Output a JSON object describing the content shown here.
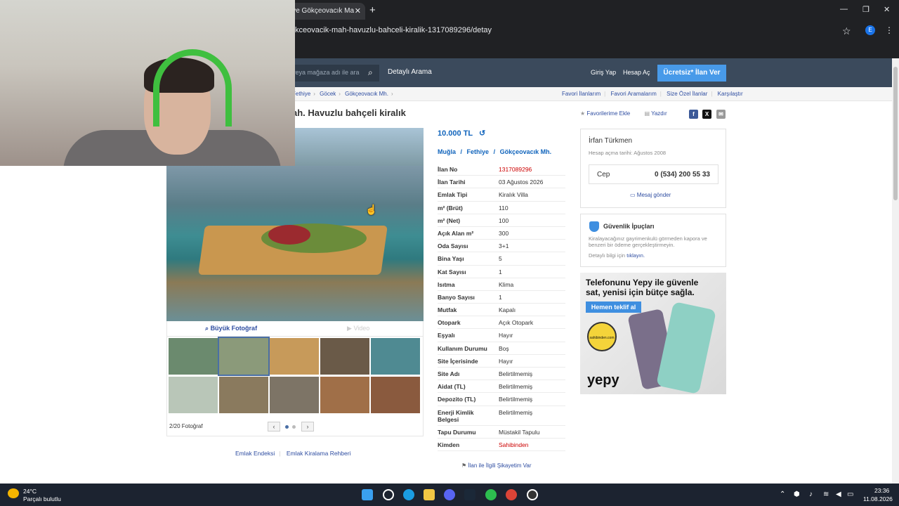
{
  "browser": {
    "tab_title": "iye Gökçeovacık Ma",
    "tab_close": "✕",
    "new_tab": "+",
    "url": "kceovacik-mah-havuzlu-bahceli-kiralik-1317089296/detay",
    "profile_initial": "E",
    "win_minimize": "—",
    "win_restore": "❐",
    "win_close": "✕"
  },
  "header": {
    "search_placeholder": "veya mağaza adı ile ara",
    "detailed_search": "Detaylı Arama",
    "login": "Giriş Yap",
    "signup": "Hesap Aç",
    "free_ad": "Ücretsiz* İlan Ver"
  },
  "breadcrumb": [
    "Fethiye",
    "Göcek",
    "Gökçeovacık Mh."
  ],
  "sublinks": [
    "Favori İlanlarım",
    "Favori Aramalarım",
    "Size Özel İlanlar",
    "Karşılaştır"
  ],
  "listing": {
    "title": "ah. Havuzlu bahçeli kiralık",
    "favorite": "Favorilerime Ekle",
    "print": "Yazdır",
    "price": "10.000 TL",
    "location": [
      "Muğla",
      "Fethiye",
      "Gökçeovacık Mh."
    ],
    "specs": [
      {
        "k": "İlan No",
        "v": "1317089296",
        "red": true
      },
      {
        "k": "İlan Tarihi",
        "v": "03 Ağustos 2026"
      },
      {
        "k": "Emlak Tipi",
        "v": "Kiralık Villa"
      },
      {
        "k": "m² (Brüt)",
        "v": "110"
      },
      {
        "k": "m² (Net)",
        "v": "100"
      },
      {
        "k": "Açık Alan m²",
        "v": "300"
      },
      {
        "k": "Oda Sayısı",
        "v": "3+1"
      },
      {
        "k": "Bina Yaşı",
        "v": "5"
      },
      {
        "k": "Kat Sayısı",
        "v": "1"
      },
      {
        "k": "Isıtma",
        "v": "Klima"
      },
      {
        "k": "Banyo Sayısı",
        "v": "1"
      },
      {
        "k": "Mutfak",
        "v": "Kapalı"
      },
      {
        "k": "Otopark",
        "v": "Açık Otopark"
      },
      {
        "k": "Eşyalı",
        "v": "Hayır"
      },
      {
        "k": "Kullanım Durumu",
        "v": "Boş"
      },
      {
        "k": "Site İçerisinde",
        "v": "Hayır"
      },
      {
        "k": "Site Adı",
        "v": "Belirtilmemiş"
      },
      {
        "k": "Aidat (TL)",
        "v": "Belirtilmemiş"
      },
      {
        "k": "Depozito (TL)",
        "v": "Belirtilmemiş"
      },
      {
        "k": "Enerji Kimlik Belgesi",
        "v": "Belirtilmemiş",
        "tall": true
      },
      {
        "k": "Tapu Durumu",
        "v": "Müstakil Tapulu"
      },
      {
        "k": "Kimden",
        "v": "Sahibinden",
        "red": true
      }
    ],
    "complaint": "İlan ile İlgili Şikayetim Var"
  },
  "gallery": {
    "big_photo": "Büyük Fotoğraf",
    "video": "Video",
    "count": "2/20 Fotoğraf",
    "prev": "‹",
    "next": "›",
    "thumb_colors": [
      "#6b8a6e",
      "#8b9a7a",
      "#c79a5a",
      "#6a5a48",
      "#4f8a92",
      "#b9c6b8",
      "#8a7a5e",
      "#7d7466",
      "#a06f48",
      "#8a5a3e"
    ]
  },
  "owner": {
    "name": "İrfan Türkmen",
    "since": "Hesap açma tarihi: Ağustos 2008",
    "phone_label": "Cep",
    "phone": "0 (534) 200 55 33",
    "message": "Mesaj gönder"
  },
  "tips": {
    "title": "Güvenlik İpuçları",
    "text": "Kiralayacağınız gayrimenkulü görmeden kapora ve benzeri bir ödeme gerçekleştirmeyin.",
    "more_prefix": "Detaylı bilgi için",
    "more_link": "tıklayın."
  },
  "ad": {
    "title": "Telefonunu Yepy ile güvenle sat, yenisi için bütçe sağla.",
    "button": "Hemen teklif al",
    "badge": "sahibinden.com",
    "logo": "yepy"
  },
  "footer": [
    "Emlak Endeksi",
    "Emlak Kiralama Rehberi"
  ],
  "taskbar": {
    "temp": "24°C",
    "weather": "Parçalı bulutlu",
    "time": "23:36",
    "date": "11.08.2026"
  },
  "colors": {
    "link": "#2e4da1",
    "price": "#1064bc",
    "accent": "#489ae9",
    "header": "#3b4a5c",
    "red": "#cc0000"
  }
}
